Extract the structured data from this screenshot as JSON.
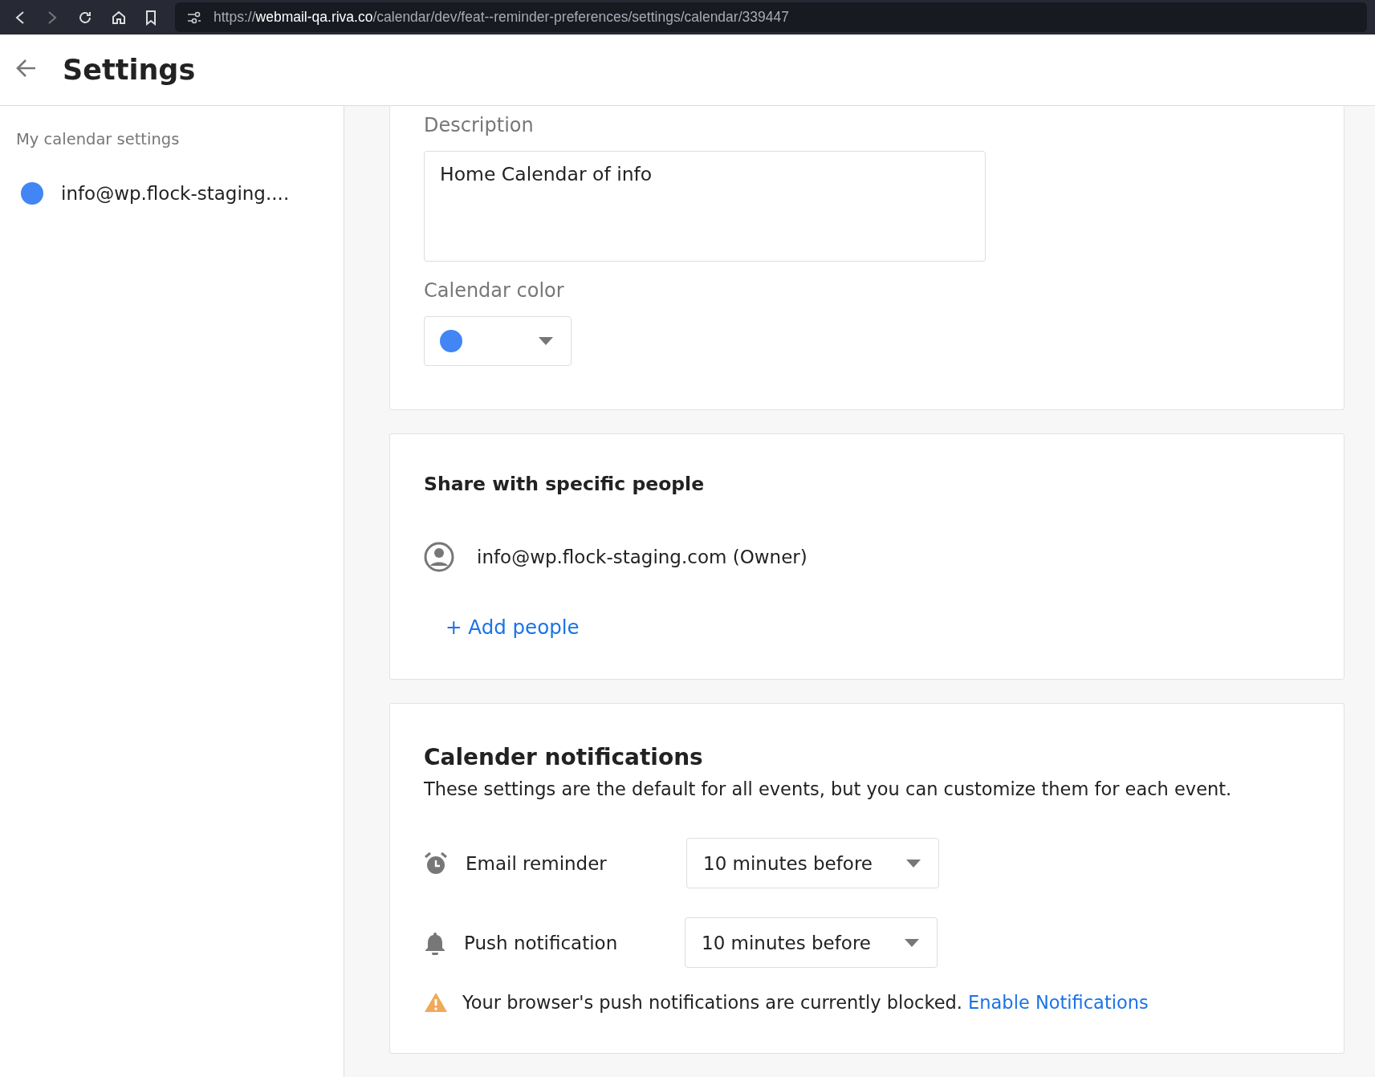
{
  "browser": {
    "url_scheme": "https://",
    "url_host": "webmail-qa.riva.co",
    "url_path": "/calendar/dev/feat--reminder-preferences/settings/calendar/339447"
  },
  "header": {
    "title": "Settings"
  },
  "sidebar": {
    "heading": "My calendar settings",
    "items": [
      {
        "label": "info@wp.flock-staging....",
        "color": "#4285f4"
      }
    ]
  },
  "details": {
    "description_label": "Description",
    "description_value": "Home Calendar of info",
    "color_label": "Calendar color",
    "color_picker": {
      "color": "#4285f4"
    }
  },
  "sharing": {
    "heading": "Share with specific people",
    "people": [
      {
        "label": "info@wp.flock-staging.com (Owner)"
      }
    ],
    "add_button": "+ Add people"
  },
  "notifications": {
    "heading": "Calender notifications",
    "description": "These settings are the default for all events, but you can customize them for each event.",
    "reminders": [
      {
        "kind": "email",
        "label": "Email reminder",
        "value": "10 minutes before"
      },
      {
        "kind": "push",
        "label": "Push notification",
        "value": "10 minutes before"
      }
    ],
    "warning": "Your browser's push notifications are currently blocked.",
    "warning_link": "Enable Notifications"
  }
}
